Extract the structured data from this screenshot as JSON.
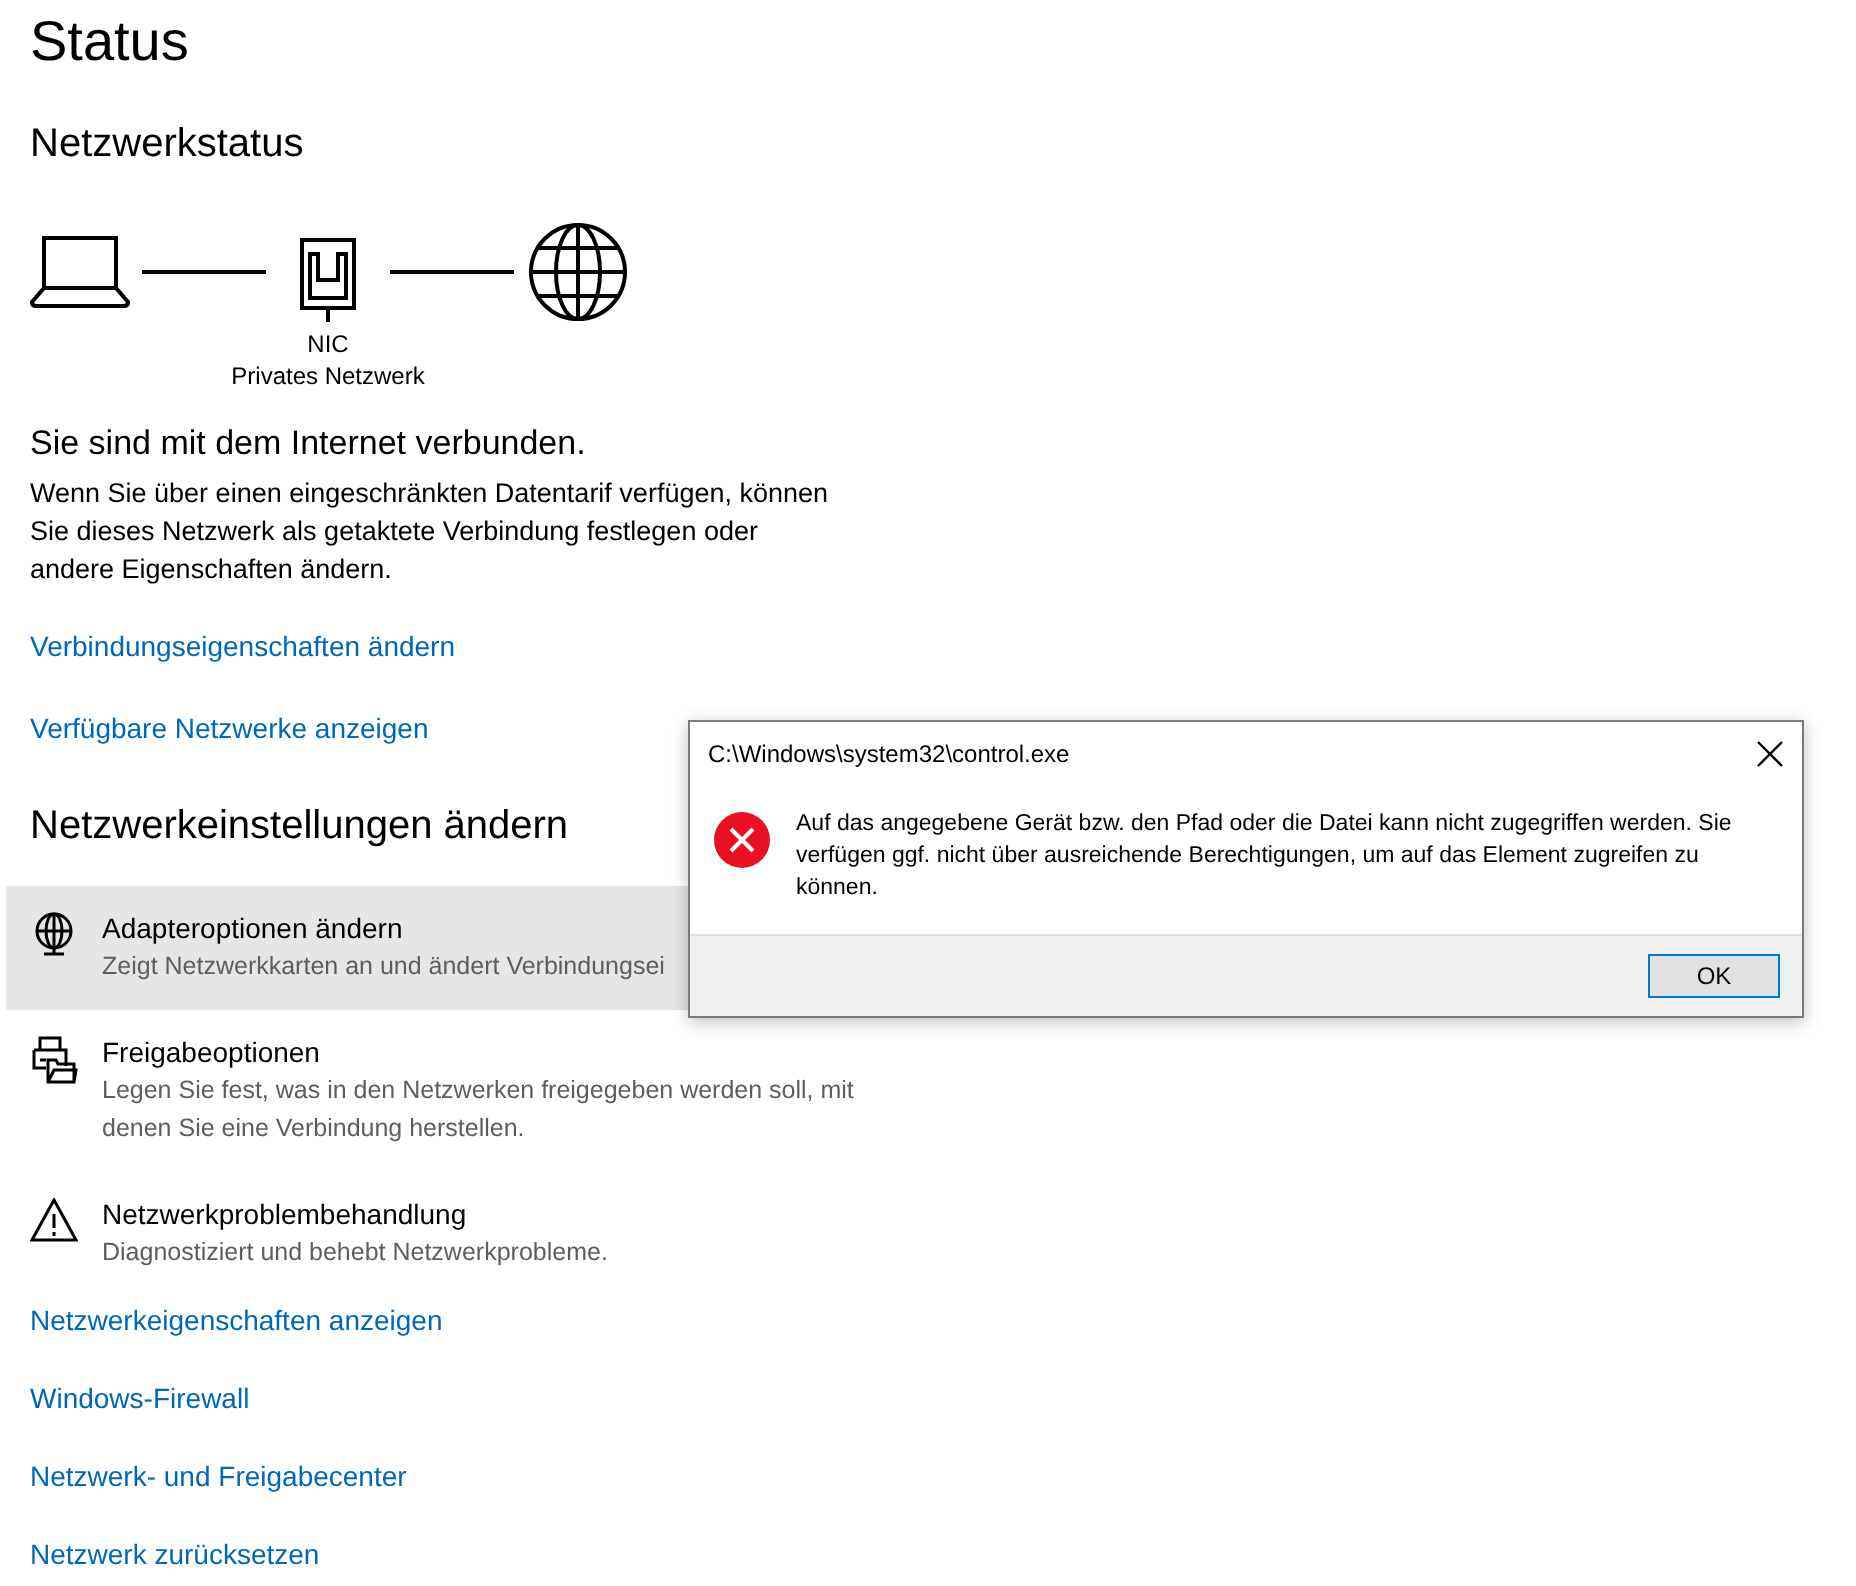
{
  "page": {
    "title": "Status"
  },
  "network_status": {
    "heading": "Netzwerkstatus",
    "diagram": {
      "adapter_label": "NIC",
      "network_label": "Privates Netzwerk"
    },
    "connection_title": "Sie sind mit dem Internet verbunden.",
    "description": "Wenn Sie über einen eingeschränkten Datentarif verfügen, können Sie dieses Netzwerk als getaktete Verbindung festlegen oder andere Eigenschaften ändern.",
    "links": [
      "Verbindungseigenschaften ändern",
      "Verfügbare Netzwerke anzeigen"
    ]
  },
  "settings": {
    "heading": "Netzwerkeinstellungen ändern",
    "items": [
      {
        "kind": "adapter",
        "title": "Adapteroptionen ändern",
        "description": "Zeigt Netzwerkkarten an und ändert Verbindungsei",
        "selected": true
      },
      {
        "kind": "sharing",
        "title": "Freigabeoptionen",
        "description": "Legen Sie fest, was in den Netzwerken freigegeben werden soll, mit denen Sie eine Verbindung herstellen.",
        "selected": false
      },
      {
        "kind": "troubleshoot",
        "title": "Netzwerkproblembehandlung",
        "description": "Diagnostiziert und behebt Netzwerkprobleme.",
        "selected": false
      }
    ],
    "links": [
      "Netzwerkeigenschaften anzeigen",
      "Windows-Firewall",
      "Netzwerk- und Freigabecenter",
      "Netzwerk zurücksetzen"
    ]
  },
  "dialog": {
    "title": "C:\\Windows\\system32\\control.exe",
    "message": "Auf das angegebene Gerät bzw. den Pfad oder die Datei kann nicht zugegriffen werden. Sie verfügen ggf. nicht über ausreichende Berechtigungen, um auf das Element zugreifen zu können.",
    "buttons": [
      "OK"
    ]
  }
}
